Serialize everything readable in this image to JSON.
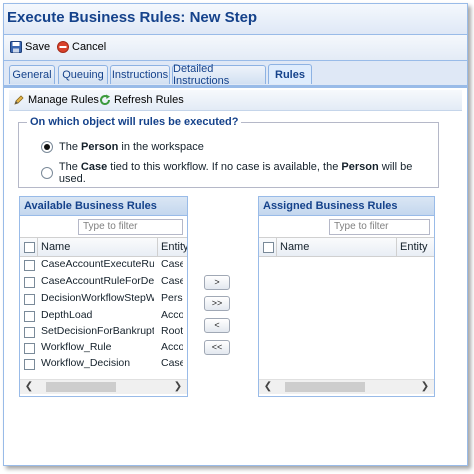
{
  "window": {
    "title": "Execute Business Rules: New Step"
  },
  "toolbar": {
    "save_label": "Save",
    "cancel_label": "Cancel"
  },
  "tabs": [
    {
      "label": "General"
    },
    {
      "label": "Queuing"
    },
    {
      "label": "Instructions"
    },
    {
      "label": "Detailed Instructions"
    },
    {
      "label": "Rules"
    }
  ],
  "active_tab": "Rules",
  "subtoolbar": {
    "manage_label": "Manage Rules",
    "refresh_label": "Refresh Rules"
  },
  "question": {
    "legend": "On which object will rules be executed?",
    "option1": {
      "pre": "The ",
      "bold": "Person",
      "post": " in the workspace",
      "selected": true
    },
    "option2": {
      "pre": "The ",
      "bold": "Case",
      "mid": " tied to this workflow. If no case is available, the ",
      "bold2": "Person",
      "post": " will be used.",
      "selected": false
    }
  },
  "available": {
    "title": "Available Business Rules",
    "filter_placeholder": "Type to filter",
    "col_name": "Name",
    "col_entity": "Entity",
    "rows": [
      {
        "name": "CaseAccountExecuteRule...",
        "entity": "Case."
      },
      {
        "name": "CaseAccountRuleForDeci...",
        "entity": "Case."
      },
      {
        "name": "DecisionWorkflowStepWit...",
        "entity": "Perso"
      },
      {
        "name": "DepthLoad",
        "entity": "Accou"
      },
      {
        "name": "SetDecisionForBankruptcy",
        "entity": "Root.I"
      },
      {
        "name": "Workflow_Rule",
        "entity": "Accou"
      },
      {
        "name": "Workflow_Decision",
        "entity": "Case."
      }
    ]
  },
  "assigned": {
    "title": "Assigned Business Rules",
    "filter_placeholder": "Type to filter",
    "col_name": "Name",
    "col_entity": "Entity"
  },
  "move_buttons": {
    "add": ">",
    "add_all": ">>",
    "remove": "<",
    "remove_all": "<<"
  },
  "colors": {
    "header_text": "#15428b",
    "border": "#99bbe8",
    "cancel_icon": "#d9412b",
    "save_icon": "#3a66b0",
    "refresh_icon": "#3c9a3c"
  }
}
